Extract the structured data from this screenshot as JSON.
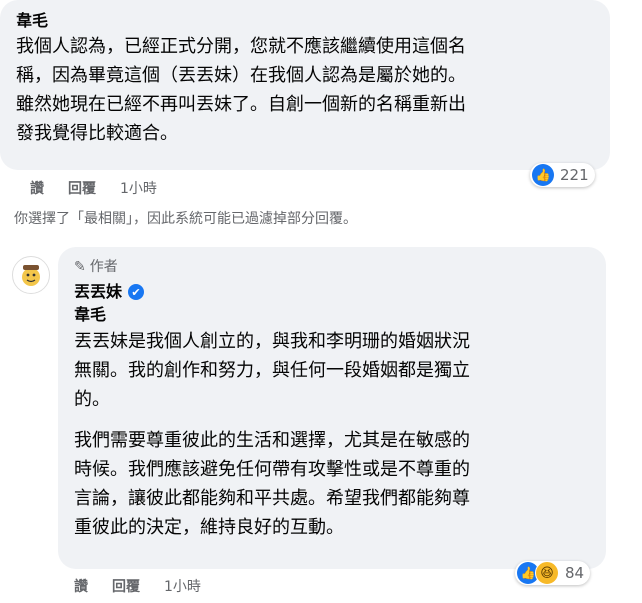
{
  "comment1": {
    "author": "韋毛",
    "text": "我個人認為，已經正式分開，您就不應該繼續使用這個名\n稱，因為畢竟這個（丟丟妹）在我個人認為是屬於她的。\n雖然她現在已經不再叫丟妹了。自創一個新的名稱重新出\n發我覺得比較適合。",
    "like_label": "讚",
    "reply_label": "回覆",
    "time": "1小時",
    "reaction_count": "221"
  },
  "filter_note": "你選擇了「最相關」，因此系統可能已過濾掉部分回覆。",
  "reply": {
    "author_badge": "作者",
    "author": "丟丟妹",
    "mention": "韋毛",
    "para1": "丟丟妹是我個人創立的，與我和李明珊的婚姻狀況\n無關。我的創作和努力，與任何一段婚姻都是獨立\n的。",
    "para2": "我們需要尊重彼此的生活和選擇，尤其是在敏感的\n時候。我們應該避免任何帶有攻擊性或是不尊重的\n言論，讓彼此都能夠和平共處。希望我們都能夠尊\n重彼此的決定，維持良好的互動。",
    "like_label": "讚",
    "reply_label": "回覆",
    "time": "1小時",
    "reaction_count": "84"
  },
  "icons": {
    "like": "like-icon",
    "haha": "haha-icon",
    "verified": "verified-badge-icon",
    "pencil": "pencil-icon"
  }
}
